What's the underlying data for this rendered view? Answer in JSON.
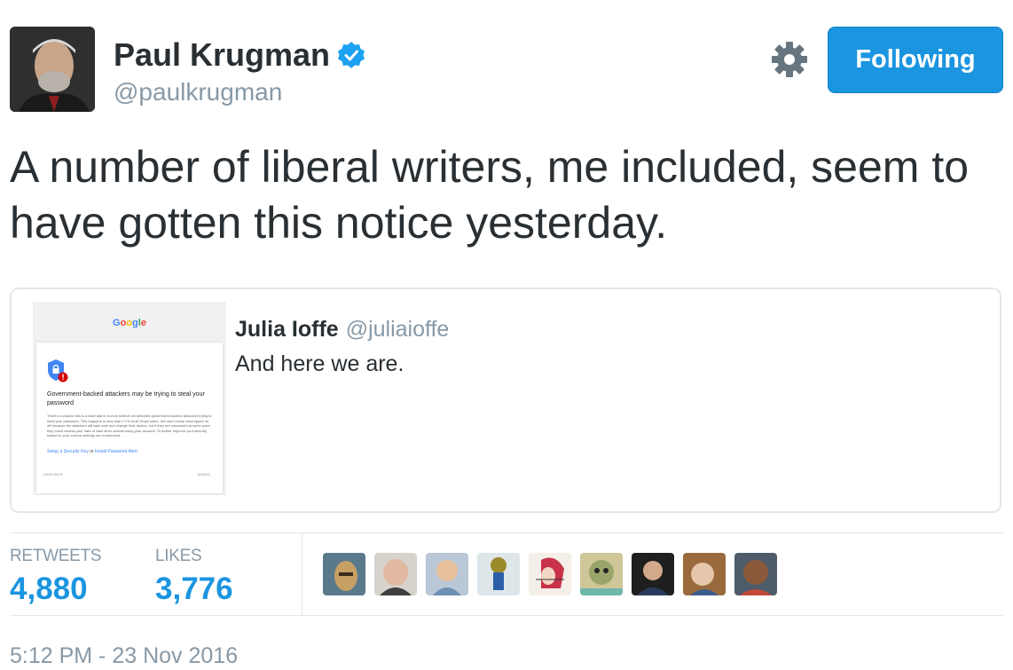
{
  "author": {
    "name": "Paul Krugman",
    "handle": "@paulkrugman",
    "follow_button": "Following"
  },
  "tweet": {
    "text": "A number of liberal writers, me included, seem to have gotten this notice yesterday.",
    "timestamp": "5:12 PM - 23 Nov 2016"
  },
  "quoted_tweet": {
    "name": "Julia Ioffe",
    "handle": "@juliaioffe",
    "text": "And here we are.",
    "image": {
      "brand": "Google",
      "heading": "Government-backed attackers may be trying to steal your password",
      "body": "There's a chance this is a false alarm, but we believe we detected government-backed attackers trying to steal your password. This happens to less than 0.1% of all Gmail users. We can't reveal what tipped us off because the attackers will take note and change their tactics, but if they are successful at some point they could access your data or take other actions using your account. To further improve your security, based on your current settings we recommend:",
      "link1": "Setup a Security Key",
      "or": "or",
      "link2": "Install Password Alert",
      "learn_more": "LEARN MORE",
      "dismiss": "DISMISS"
    }
  },
  "stats": {
    "retweets_label": "RETWEETS",
    "retweets_value": "4,880",
    "likes_label": "LIKES",
    "likes_value": "3,776"
  },
  "colors": {
    "accent": "#1b95e0",
    "muted": "#8899a6",
    "text": "#292f33",
    "border": "#e1e8ed"
  }
}
